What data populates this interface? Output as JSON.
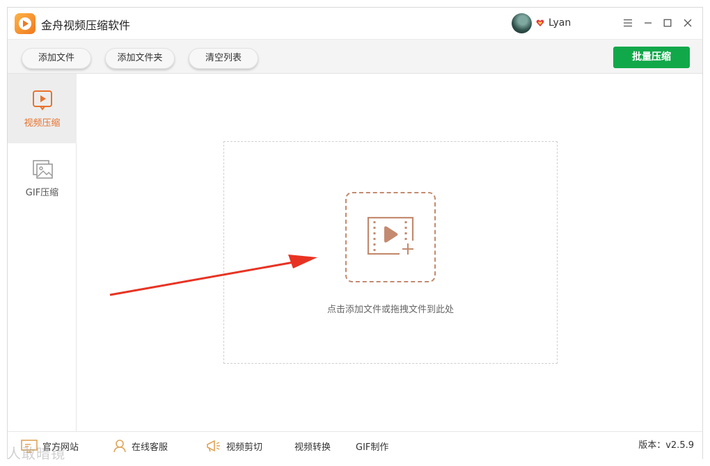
{
  "app": {
    "title": "金舟视频压缩软件"
  },
  "user": {
    "name": "Lyan"
  },
  "toolbar": {
    "add_file": "添加文件",
    "add_folder": "添加文件夹",
    "clear_list": "清空列表",
    "batch_compress": "批量压缩"
  },
  "sidebar": {
    "items": [
      {
        "label": "视频压缩",
        "icon": "video-play-icon",
        "active": true
      },
      {
        "label": "GIF压缩",
        "icon": "image-icon",
        "active": false
      }
    ]
  },
  "main": {
    "drop_hint": "点击添加文件或拖拽文件到此处"
  },
  "footer": {
    "website": "官方网站",
    "support": "在线客服",
    "video_cut": "视频剪切",
    "video_convert": "视频转换",
    "gif_make": "GIF制作",
    "version": "版本：v2.5.9"
  },
  "watermark": "人敢暗镜",
  "colors": {
    "accent": "#e8722c",
    "primary": "#11a84a",
    "icon_brown": "#c38a6f",
    "arrow": "#e83323"
  }
}
